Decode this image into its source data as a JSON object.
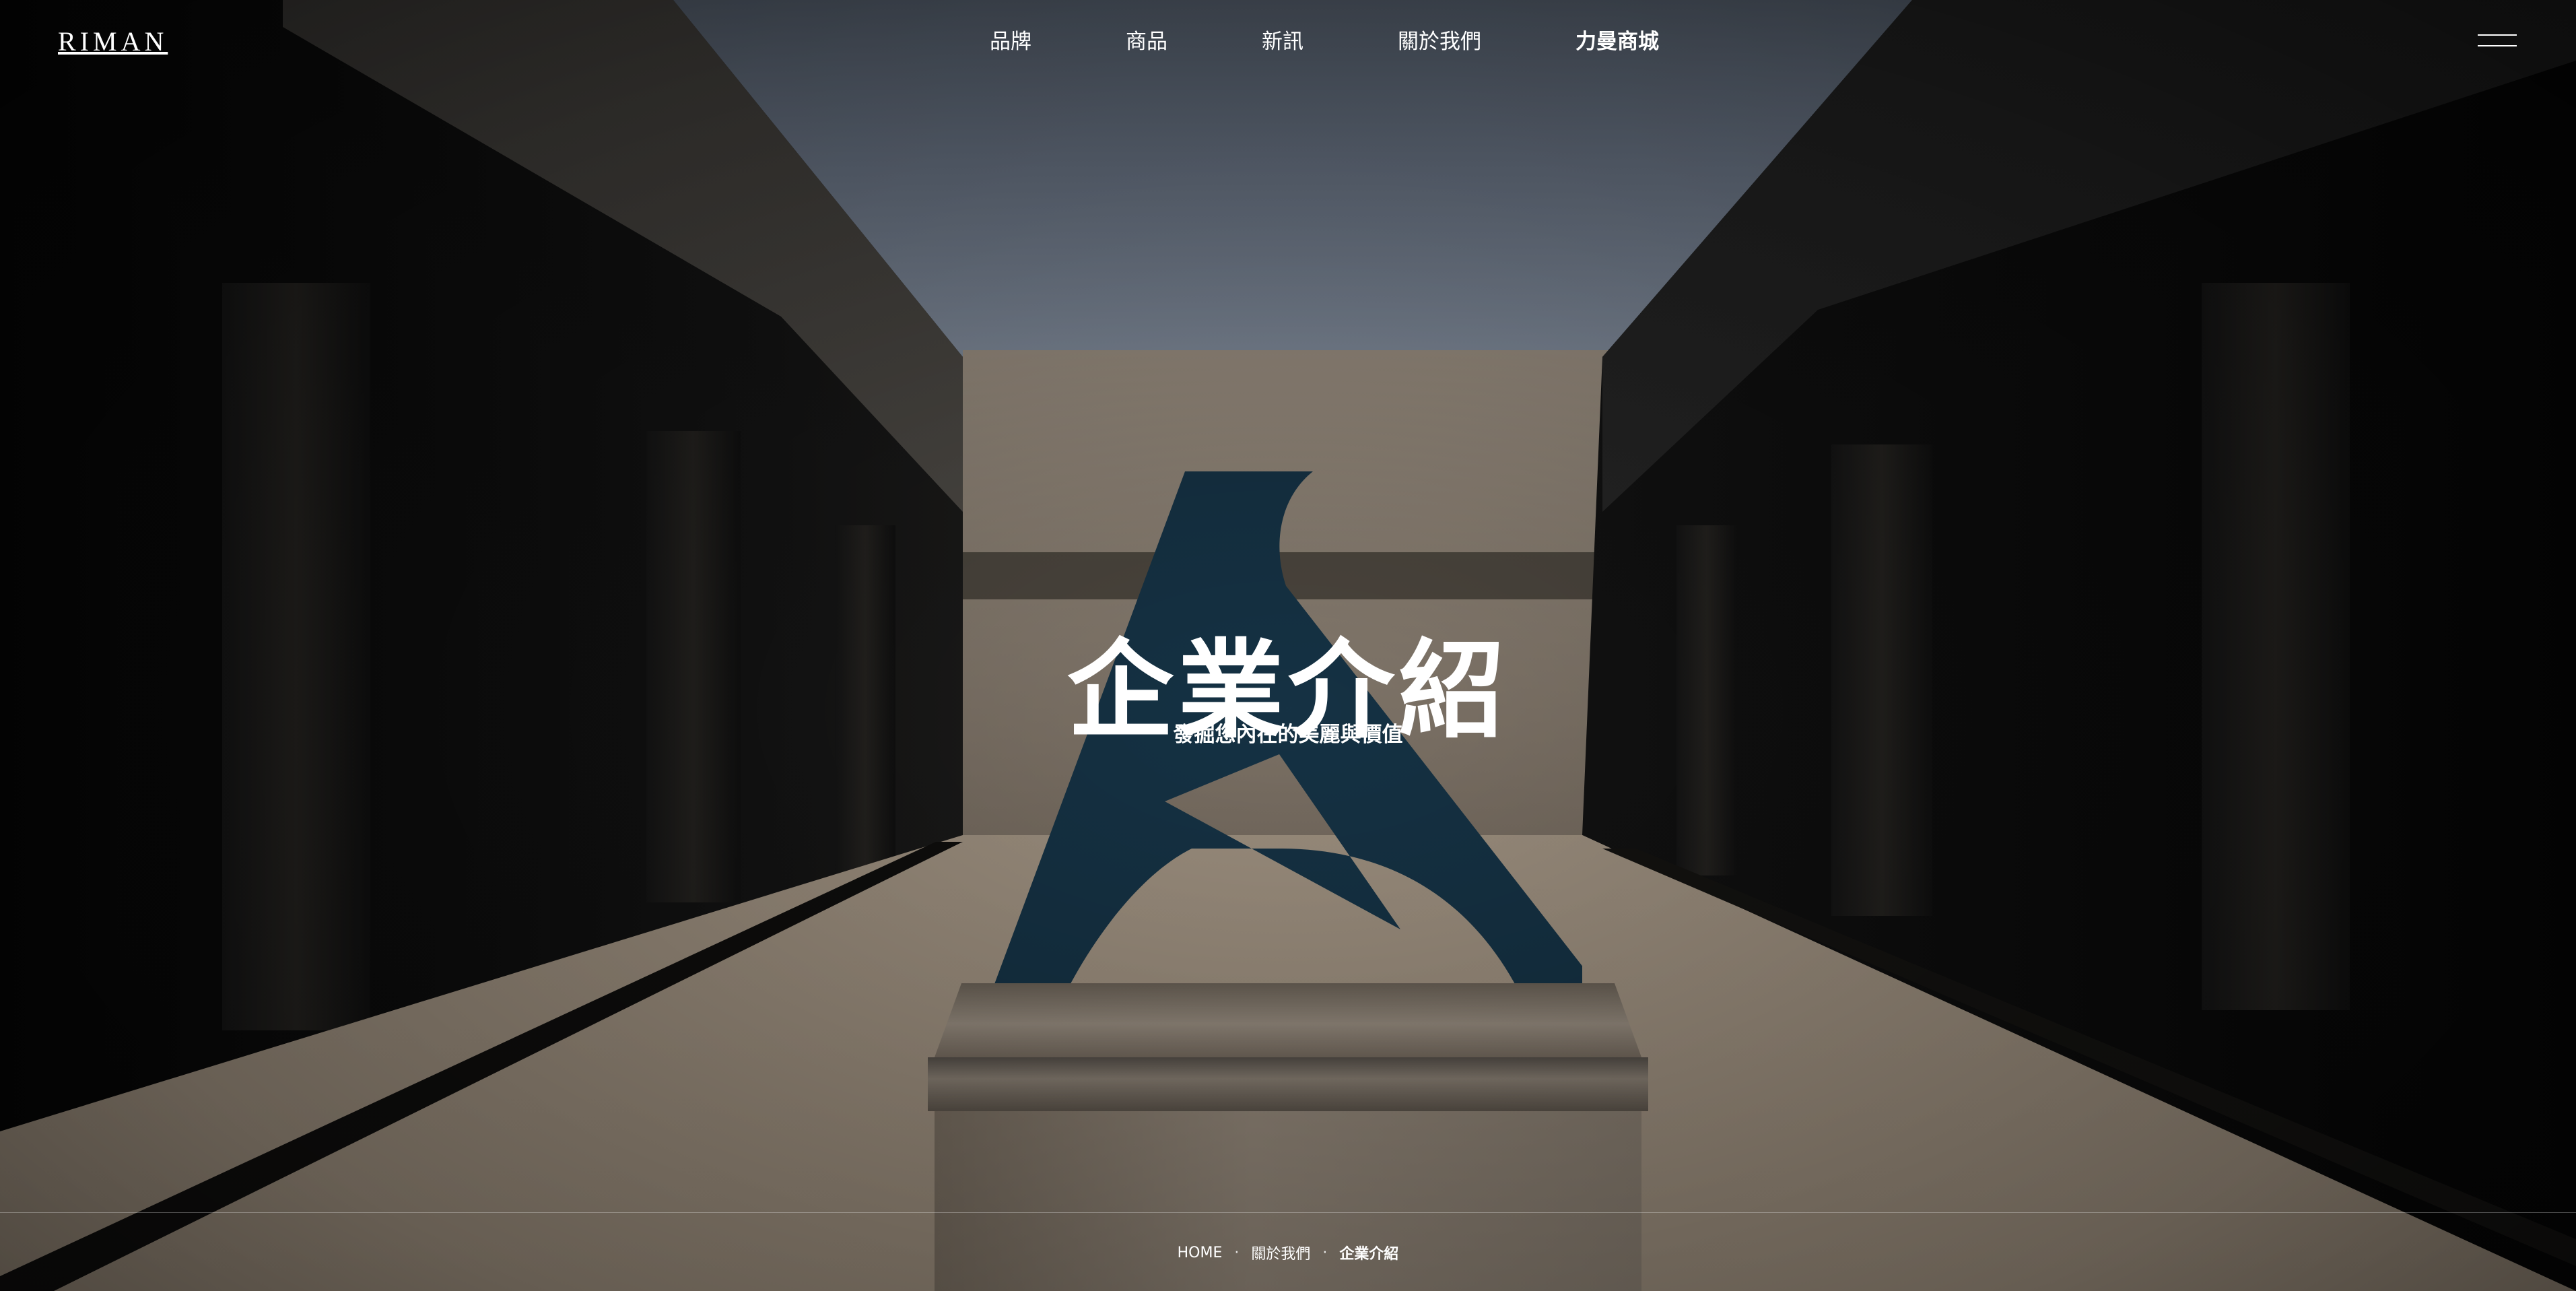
{
  "header": {
    "logo": "RIMAN",
    "nav": [
      {
        "label": "品牌"
      },
      {
        "label": "商品"
      },
      {
        "label": "新訊"
      },
      {
        "label": "關於我們"
      },
      {
        "label": "力曼商城"
      }
    ],
    "menu_icon": "hamburger-menu-icon"
  },
  "hero": {
    "title": "企業介紹",
    "subtitle": "發掘您內在的美麗與價值",
    "sculpture_color": "#163447"
  },
  "breadcrumb": {
    "items": [
      "HOME",
      "關於我們",
      "企業介紹"
    ],
    "separator": "·"
  },
  "colors": {
    "text": "#ffffff",
    "sculpture": "#163447"
  }
}
